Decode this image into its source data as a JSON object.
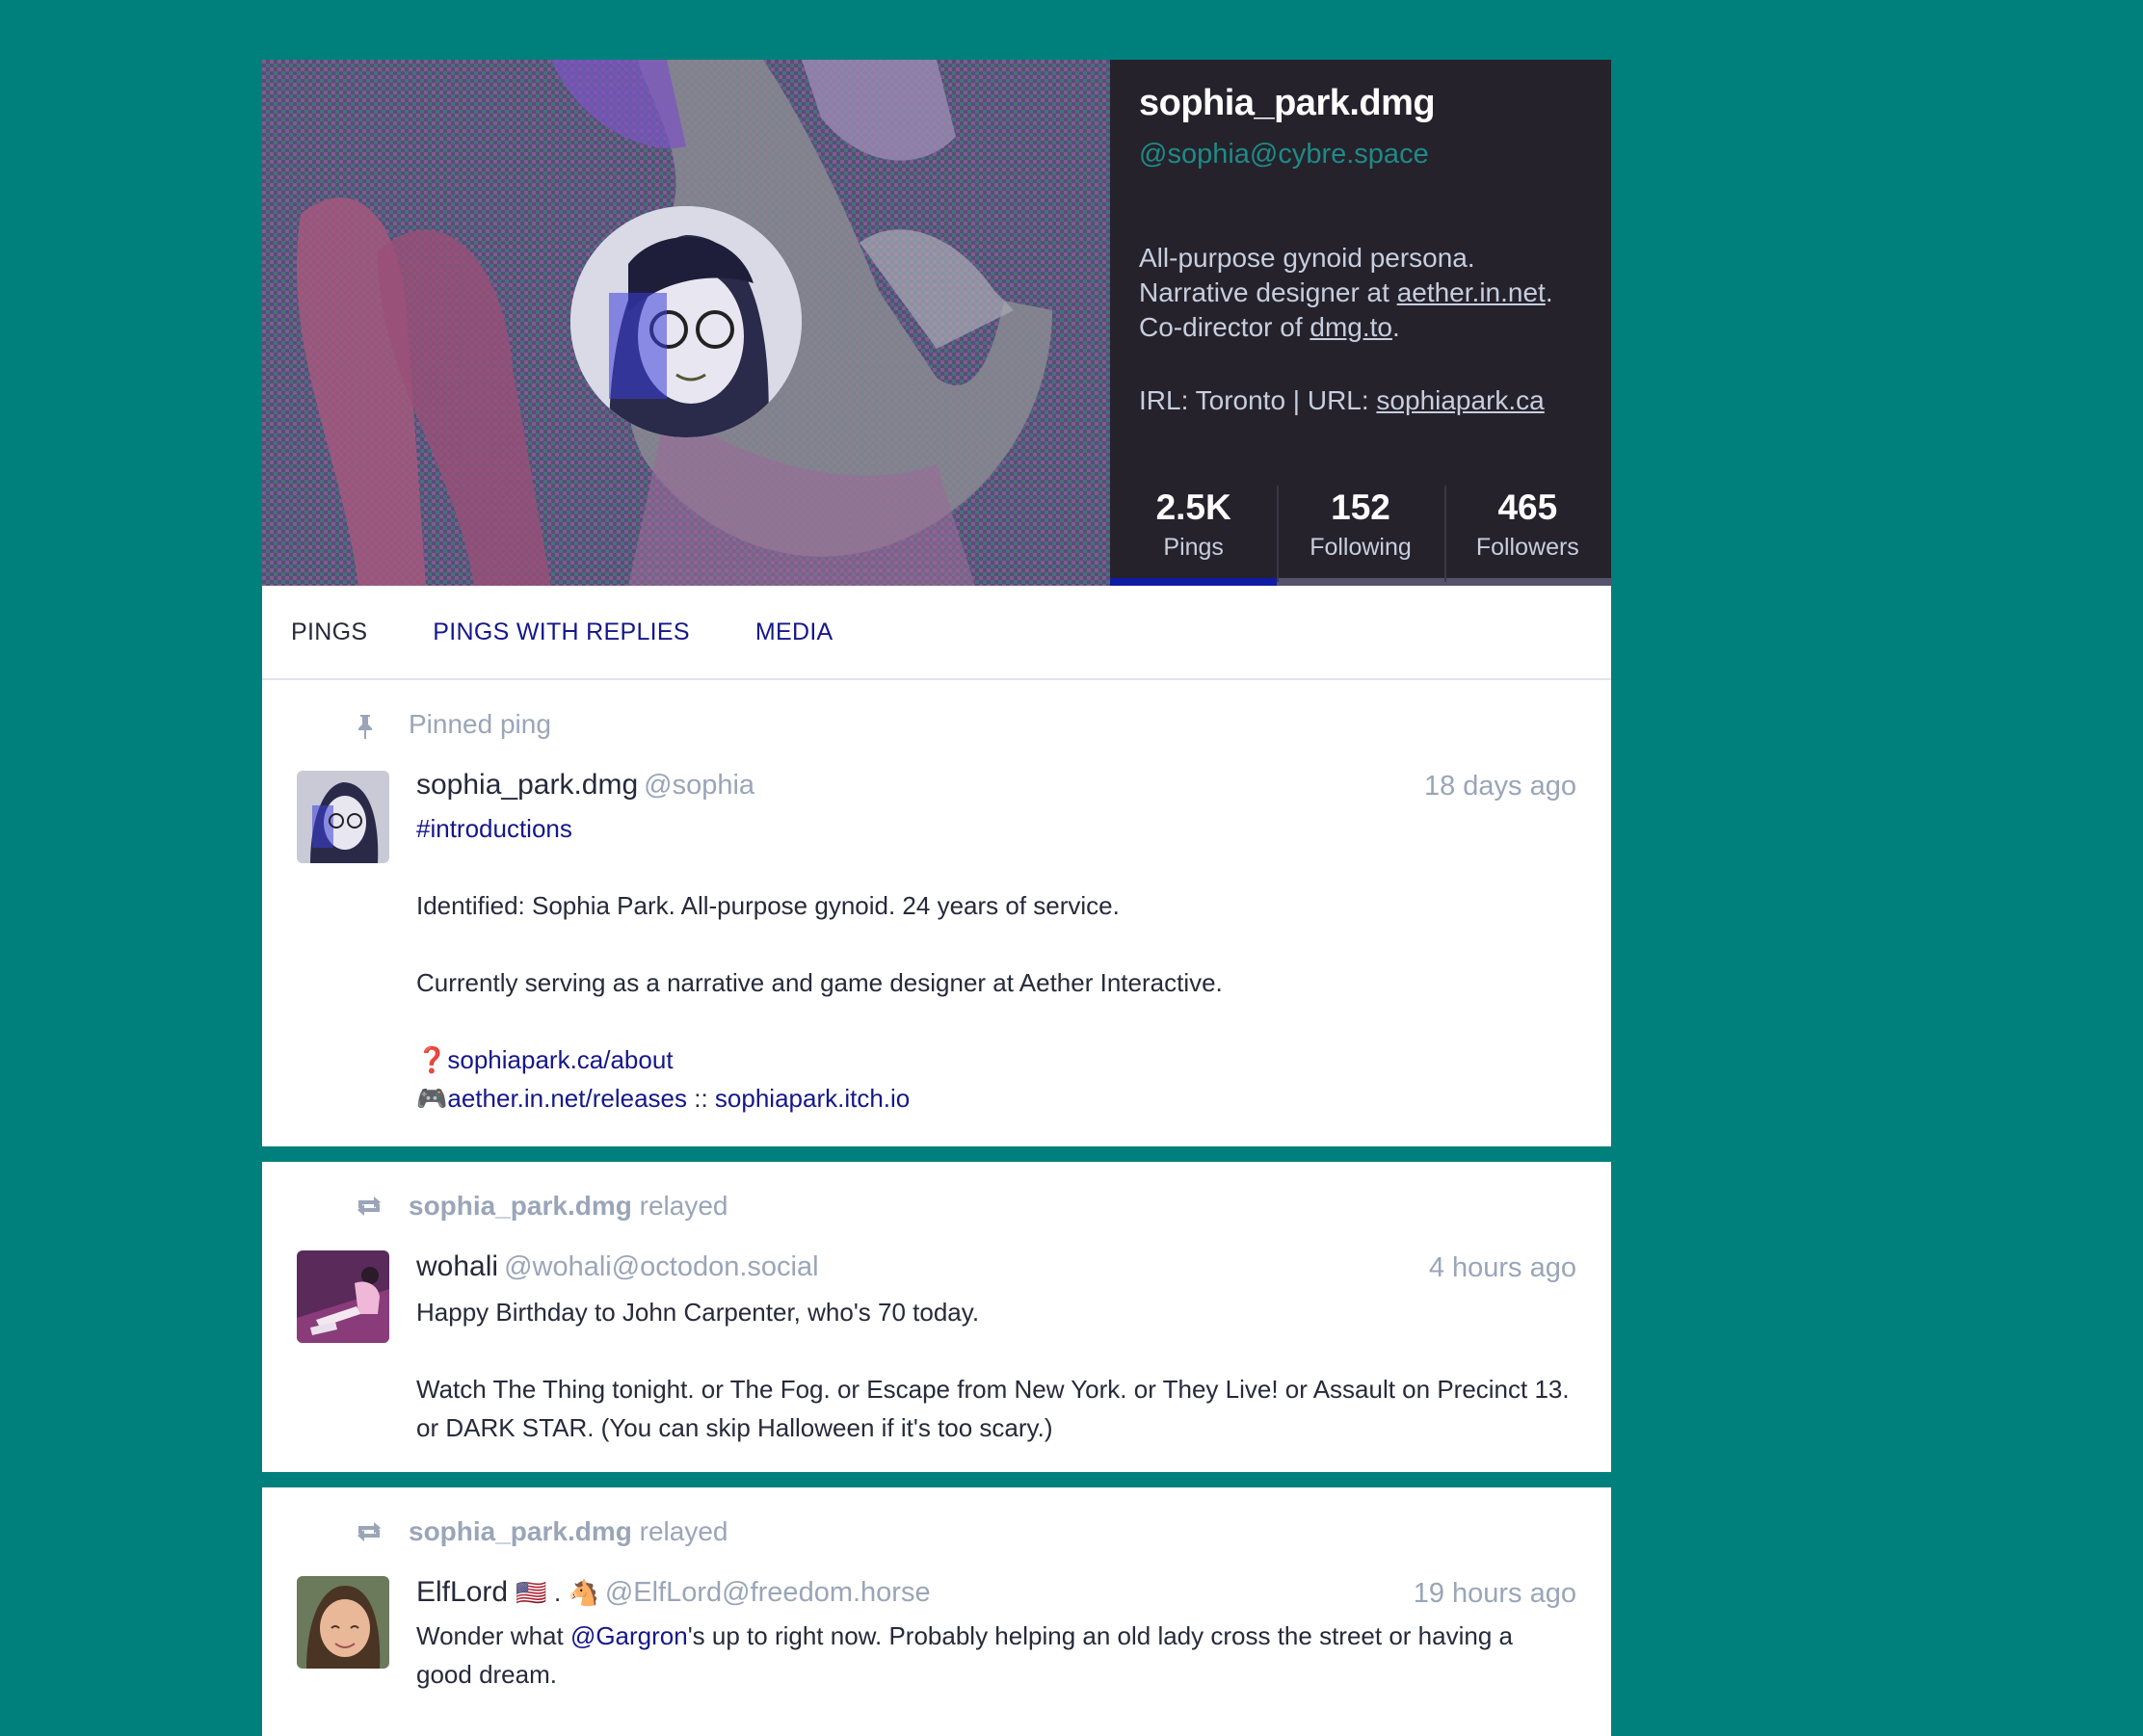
{
  "profile": {
    "display_name": "sophia_park.dmg",
    "account": "@sophia@cybre.space",
    "bio": {
      "line1": "All-purpose gynoid persona.",
      "line2_prefix": "Narrative designer at ",
      "line2_link": "aether.in.net",
      "line2_suffix": ".",
      "line3_prefix": "Co-director of ",
      "line3_link": "dmg.to",
      "line3_suffix": ".",
      "line4_prefix": "IRL: Toronto | URL: ",
      "line4_link": "sophiapark.ca"
    },
    "stats": [
      {
        "value": "2.5K",
        "label": "Pings"
      },
      {
        "value": "152",
        "label": "Following"
      },
      {
        "value": "465",
        "label": "Followers"
      }
    ]
  },
  "tabs": [
    "PINGS",
    "PINGS WITH REPLIES",
    "MEDIA"
  ],
  "statuses": [
    {
      "prepend": "Pinned ping",
      "name": "sophia_park.dmg",
      "handle": "@sophia",
      "time": "18 days ago",
      "hashtag": "#introductions",
      "para1": "Identified: Sophia Park. All-purpose gynoid. 24 years of service.",
      "para2": "Currently serving as a narrative and game designer at Aether Interactive.",
      "link1_emoji": "❓",
      "link1": "sophiapark.ca/about",
      "link2_emoji": "🎮",
      "link2a": "aether.in.net/releases",
      "link2_sep": " :: ",
      "link2b": "sophiapark.itch.io"
    },
    {
      "prepend_name": "sophia_park.dmg",
      "prepend_action": "relayed",
      "name": "wohali",
      "handle": "@wohali@octodon.social",
      "time": "4 hours ago",
      "para1": "Happy Birthday to John Carpenter, who's 70 today.",
      "para2": "Watch The Thing tonight. or The Fog. or Escape from New York. or They Live! or Assault on Precinct 13. or DARK STAR. (You can skip Halloween if it's too scary.)"
    },
    {
      "prepend_name": "sophia_park.dmg",
      "prepend_action": "relayed",
      "name": "ElfLord",
      "name_emoji": "🇺🇸 . 🐴",
      "handle": "@ElfLord@freedom.horse",
      "time": "19 hours ago",
      "text_prefix": "Wonder what ",
      "mention": "@Gargron",
      "text_suffix": "'s up to right now. Probably helping an old lady cross the street or having a good dream."
    }
  ],
  "icons": {
    "pin": "pin-icon",
    "relay": "relay-icon"
  }
}
